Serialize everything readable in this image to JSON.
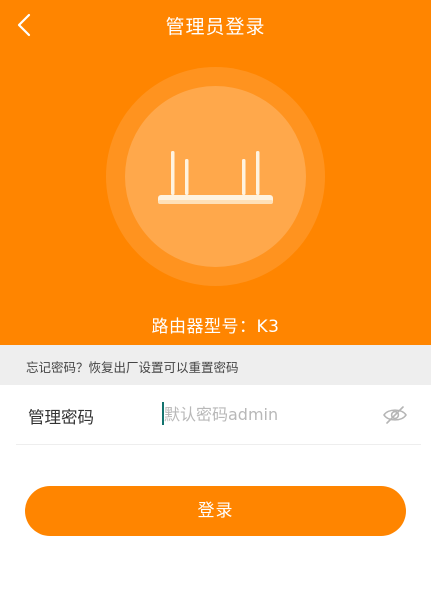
{
  "header": {
    "title": "管理员登录",
    "back_icon": "chevron-left-icon",
    "device_icon": "router-icon",
    "model_text": "路由器型号：K3"
  },
  "hint": {
    "text": "忘记密码？恢复出厂设置可以重置密码"
  },
  "password_field": {
    "label": "管理密码",
    "value": "",
    "placeholder": "默认密码admin",
    "visibility_icon": "eye-hidden-icon"
  },
  "login_button": {
    "label": "登录"
  },
  "colors": {
    "accent": "#ff8500",
    "hint_bg": "#eeeeee",
    "cursor": "#12736e"
  }
}
